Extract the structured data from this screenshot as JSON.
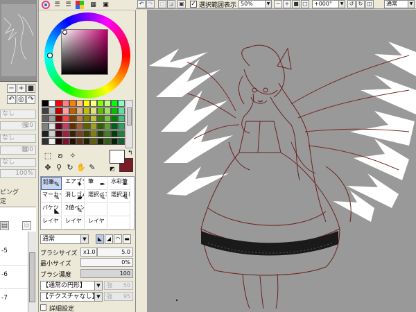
{
  "toolbar": {
    "selection_label": "選択範囲表示",
    "selection_checked": "✓",
    "zoom_value": "50%",
    "rotation_value": "+000°",
    "blend_mode": "通常"
  },
  "layers_panel": {
    "field_1": {
      "label": "なし",
      "value": ""
    },
    "field_2": {
      "label": "強",
      "value": "20"
    },
    "field_3": {
      "label": "なし",
      "value": ""
    },
    "field_4": {
      "label": "強",
      "value": "100"
    },
    "field_5": {
      "label": "なし",
      "value": ""
    },
    "field_6": {
      "label": "",
      "value": "100%"
    },
    "label_a": "ピング",
    "label_b": "定",
    "layers": [
      "-5",
      "-6",
      "-7"
    ]
  },
  "tools_panel": {
    "tabs": [
      "color-wheel-tab",
      "rgb-sliders-tab",
      "hsv-sliders-tab",
      "palette-grid-tab",
      "swatch-tab",
      "scratchpad-tab"
    ],
    "foreground_color": "#ffffff",
    "background_color": "#7a1a24",
    "brushes": [
      {
        "label": "鉛筆",
        "glyph": "✎",
        "selected": true
      },
      {
        "label": "エアブラシ",
        "glyph": "✦",
        "selected": false
      },
      {
        "label": "筆",
        "glyph": "✒",
        "selected": false
      },
      {
        "label": "水彩筆",
        "glyph": "✒",
        "selected": false
      },
      {
        "label": "マーカー",
        "glyph": "✎",
        "selected": false
      },
      {
        "label": "消しゴム",
        "glyph": "▰",
        "selected": false
      },
      {
        "label": "選択ペン",
        "glyph": "✎",
        "selected": false
      },
      {
        "label": "選択消し",
        "glyph": "✎",
        "selected": false
      },
      {
        "label": "バケツ",
        "glyph": "◣",
        "selected": false
      },
      {
        "label": "2値ペン",
        "glyph": "✎",
        "selected": false
      },
      {
        "label": "",
        "glyph": "",
        "selected": false
      },
      {
        "label": "",
        "glyph": "",
        "selected": false
      },
      {
        "label": "レイヤ",
        "glyph": "",
        "selected": false
      },
      {
        "label": "レイヤ",
        "glyph": "",
        "selected": false
      },
      {
        "label": "レイヤ",
        "glyph": "",
        "selected": false
      },
      {
        "label": "",
        "glyph": "",
        "selected": false
      }
    ],
    "blend_mode": "通常",
    "brush_size_label": "ブラシサイズ",
    "brush_size_multiplier": "x1.0",
    "brush_size_value": "5.0",
    "min_size_label": "最小サイズ",
    "min_size_value": "0%",
    "brush_density_label": "ブラシ濃度",
    "brush_density_value": "100",
    "shape_dropdown": "【通常の円形】",
    "shape_strength_label": "強",
    "shape_strength_value": "50",
    "texture_dropdown": "【テクスチャなし】",
    "texture_strength_label": "強",
    "texture_strength_value": "95",
    "detail_label": "詳細設定"
  },
  "icons": {
    "undo": "undo-icon",
    "redo": "redo-icon",
    "deselect": "deselect-icon",
    "invert": "invert-selection-icon",
    "zoom_out": "zoom-out-icon",
    "zoom_in": "zoom-in-icon",
    "rotate_left": "rotate-left-icon",
    "rotate_right": "rotate-right-icon",
    "reset_rotation": "reset-rotation-icon",
    "flip": "flip-icon"
  }
}
